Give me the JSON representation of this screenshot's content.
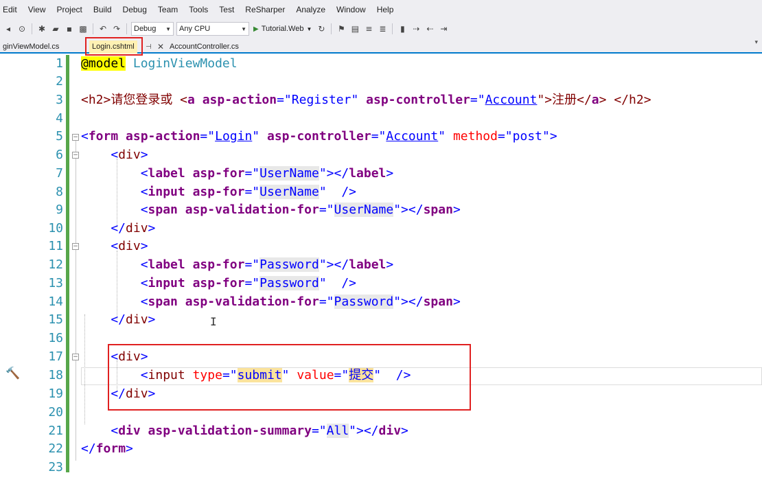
{
  "menu": [
    "Edit",
    "View",
    "Project",
    "Build",
    "Debug",
    "Team",
    "Tools",
    "Test",
    "ReSharper",
    "Analyze",
    "Window",
    "Help"
  ],
  "toolbar": {
    "configuration": "Debug",
    "platform": "Any CPU",
    "run_target": "Tutorial.Web"
  },
  "tabs": {
    "left": "ginViewModel.cs",
    "active": "Login.cshtml",
    "right": "AccountController.cs"
  },
  "line_numbers": [
    "1",
    "2",
    "3",
    "4",
    "5",
    "6",
    "7",
    "8",
    "9",
    "10",
    "11",
    "12",
    "13",
    "14",
    "15",
    "16",
    "17",
    "18",
    "19",
    "20",
    "21",
    "22",
    "23"
  ],
  "code": {
    "l1": [
      "@model",
      " ",
      "LoginViewModel"
    ],
    "l3": [
      "<h2>请您登录或 <",
      "a",
      " ",
      "asp-action",
      "=\"",
      "Register",
      "\"",
      " ",
      "asp-controller",
      "=\"",
      "Account",
      "\">注册</",
      "a",
      "> </",
      "h2",
      ">"
    ],
    "l5": [
      "<",
      "form",
      " ",
      "asp-action",
      "=\"",
      "Login",
      "\"",
      " ",
      "asp-controller",
      "=\"",
      "Account",
      "\"",
      " ",
      "method",
      "=\"",
      "post",
      "\">"
    ],
    "l6": [
      "    <",
      "div",
      ">"
    ],
    "l7": [
      "        <",
      "label",
      " ",
      "asp-for",
      "=\"",
      "UserName",
      "\"></",
      "label",
      ">"
    ],
    "l8": [
      "        <",
      "input",
      " ",
      "asp-for",
      "=\"",
      "UserName",
      "\"",
      "  />"
    ],
    "l9": [
      "        <",
      "span",
      " ",
      "asp-validation-for",
      "=\"",
      "UserName",
      "\"></",
      "span",
      ">"
    ],
    "l10": [
      "    </",
      "div",
      ">"
    ],
    "l11": [
      "    <",
      "div",
      ">"
    ],
    "l12": [
      "        <",
      "label",
      " ",
      "asp-for",
      "=\"",
      "Password",
      "\"></",
      "label",
      ">"
    ],
    "l13": [
      "        <",
      "input",
      " ",
      "asp-for",
      "=\"",
      "Password",
      "\"",
      "  />"
    ],
    "l14": [
      "        <",
      "span",
      " ",
      "asp-validation-for",
      "=\"",
      "Password",
      "\"></",
      "span",
      ">"
    ],
    "l15": [
      "    </",
      "div",
      ">"
    ],
    "l17": [
      "    <",
      "div",
      ">"
    ],
    "l18": [
      "        <",
      "input",
      " ",
      "type",
      "=\"",
      "submit",
      "\"",
      " ",
      "value",
      "=\"",
      "提交",
      "\"",
      "  />"
    ],
    "l19": [
      "    </",
      "div",
      ">"
    ],
    "l21": [
      "    <",
      "div",
      " ",
      "asp-validation-summary",
      "=\"",
      "All",
      "\"></",
      "div",
      ">"
    ],
    "l22": [
      "</",
      "form",
      ">"
    ]
  },
  "colors": {
    "line_number": "#2b91af",
    "tag_name": "#800080",
    "attribute_value": "#0000ff",
    "html_attribute": "#ff0000",
    "change_bar": "#57a64a",
    "annotation_box": "#e02020"
  }
}
